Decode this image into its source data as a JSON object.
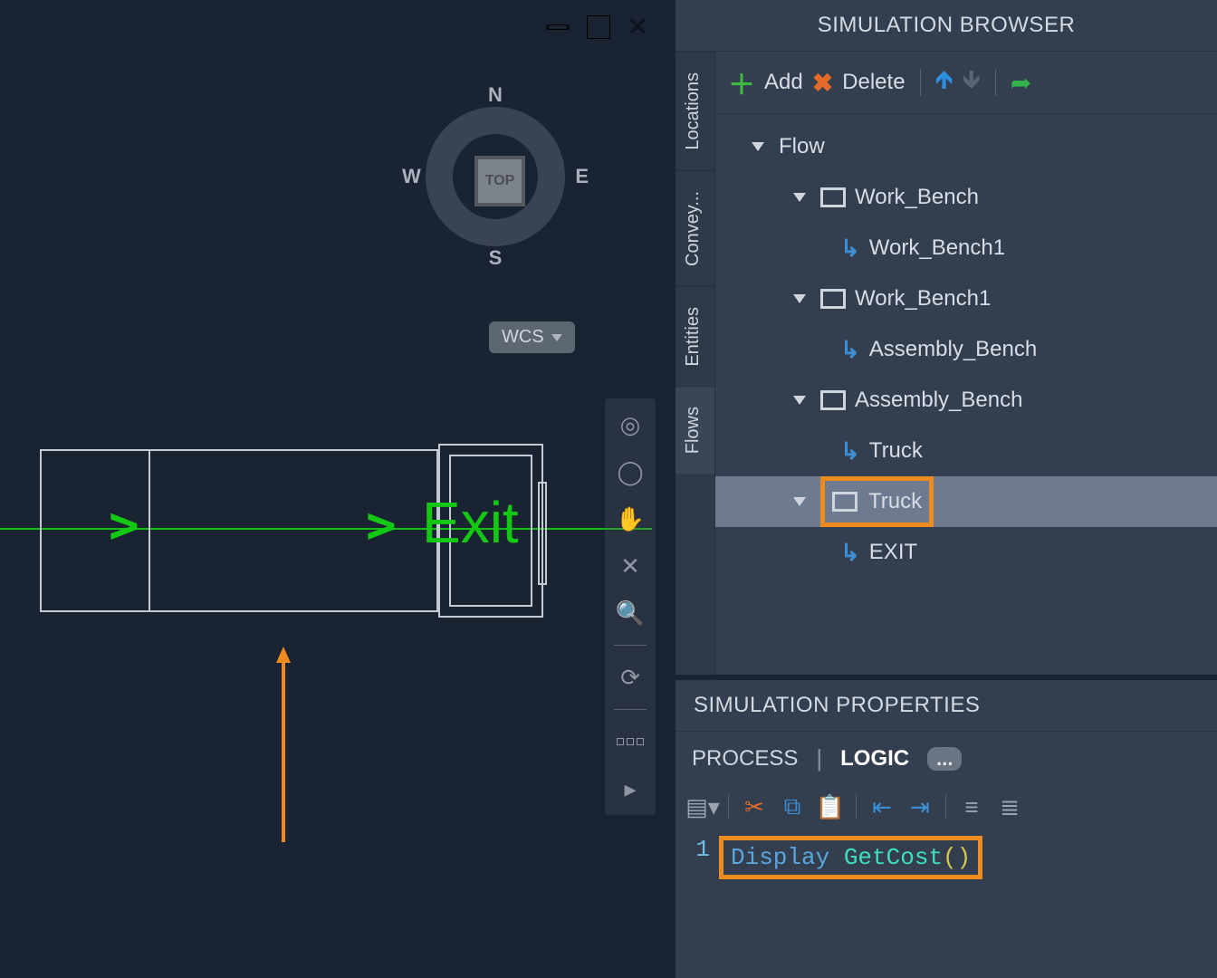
{
  "compass": {
    "top": "TOP",
    "n": "N",
    "s": "S",
    "e": "E",
    "w": "W"
  },
  "wcs_label": "WCS",
  "exit_label": "Exit",
  "browser": {
    "title": "SIMULATION BROWSER",
    "vtabs": {
      "locations": "Locations",
      "convey": "Convey...",
      "entities": "Entities",
      "flows": "Flows"
    },
    "toolbar": {
      "add": "Add",
      "delete": "Delete"
    },
    "tree": {
      "root": "Flow",
      "n_workbench": "Work_Bench",
      "sub_workbench1": "Work_Bench1",
      "n_workbench1": "Work_Bench1",
      "sub_assembly": "Assembly_Bench",
      "n_assembly": "Assembly_Bench",
      "sub_truck": "Truck",
      "n_truck": "Truck",
      "sub_exit": "EXIT"
    }
  },
  "props": {
    "title": "SIMULATION PROPERTIES",
    "tab_process": "PROCESS",
    "tab_logic": "LOGIC",
    "more": "...",
    "code": {
      "line": "1",
      "kw1": "Display",
      "kw2": "GetCost",
      "paren": "()"
    }
  }
}
